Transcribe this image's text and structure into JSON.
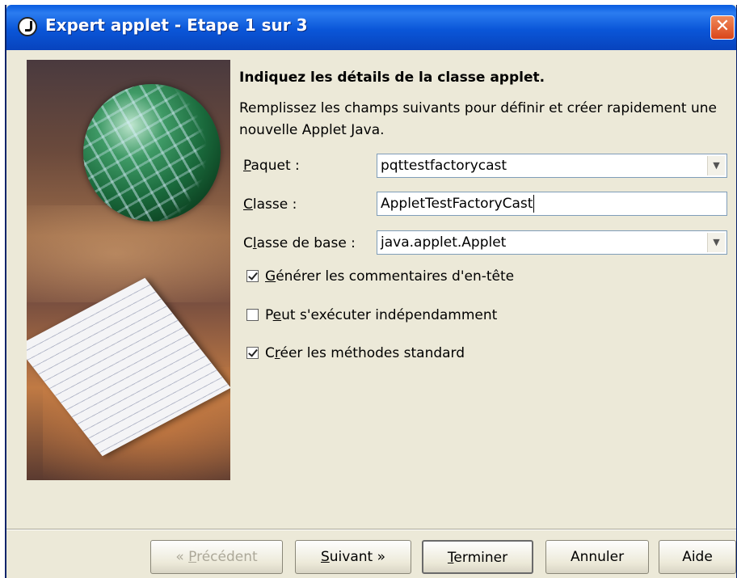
{
  "window": {
    "title": "Expert applet - Etape 1 sur 3",
    "close_label": "✕"
  },
  "content": {
    "heading": "Indiquez les détails de la classe applet.",
    "description": "Remplissez les champs suivants pour définir et créer rapidement une nouvelle Applet Java."
  },
  "form": {
    "package": {
      "label_u": "P",
      "label_rest": "aquet :",
      "value": "pqttestfactorycast"
    },
    "class": {
      "label_u": "C",
      "label_rest": "lasse :",
      "value": "AppletTestFactoryCast"
    },
    "base_class": {
      "label_pre": "C",
      "label_u": "l",
      "label_rest": "asse de base :",
      "value": "java.applet.Applet"
    }
  },
  "options": [
    {
      "pre": "",
      "u": "G",
      "rest": "énérer les commentaires d'en-tête",
      "checked": true
    },
    {
      "pre": "P",
      "u": "e",
      "rest": "ut s'exécuter indépendamment",
      "checked": false
    },
    {
      "pre": "C",
      "u": "r",
      "rest": "éer les méthodes standard",
      "checked": true
    }
  ],
  "buttons": {
    "previous": {
      "pre": "« ",
      "u": "P",
      "rest": "récédent"
    },
    "next": {
      "pre": "",
      "u": "S",
      "rest": "uivant »"
    },
    "finish": {
      "pre": "",
      "u": "T",
      "rest": "erminer"
    },
    "cancel": "Annuler",
    "help": "Aide"
  }
}
